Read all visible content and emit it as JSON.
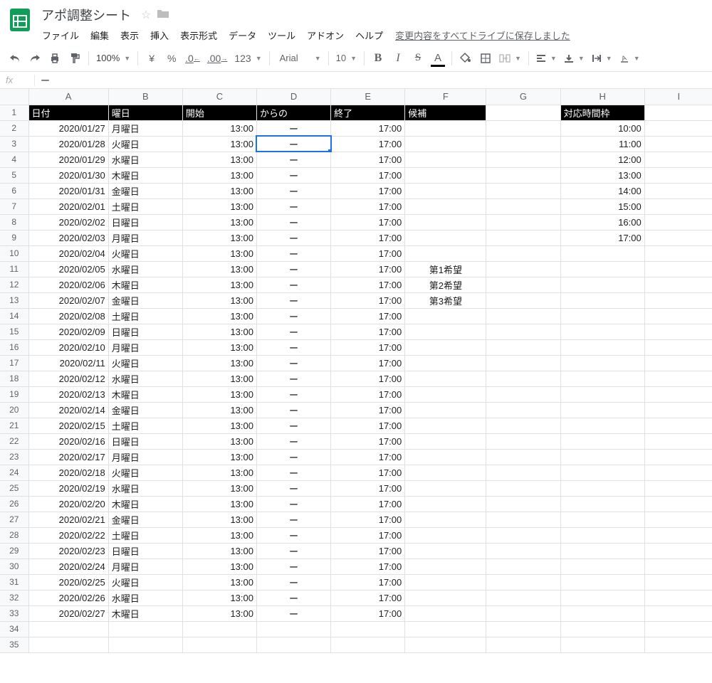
{
  "doc_title": "アポ調整シート",
  "menus": [
    "ファイル",
    "編集",
    "表示",
    "挿入",
    "表示形式",
    "データ",
    "ツール",
    "アドオン",
    "ヘルプ"
  ],
  "save_status": "変更内容をすべてドライブに保存しました",
  "toolbar": {
    "zoom": "100%",
    "currency": "¥",
    "percent": "%",
    "dec_dec": ".0",
    "inc_dec": ".00",
    "num_fmt": "123",
    "font_name": "Arial",
    "font_size": "10",
    "text_color_letter": "A"
  },
  "formula_bar": {
    "fx": "fx",
    "value": "ー"
  },
  "columns": [
    "A",
    "B",
    "C",
    "D",
    "E",
    "F",
    "G",
    "H",
    "I"
  ],
  "header_row": {
    "A": "日付",
    "B": "曜日",
    "C": "開始",
    "D": "からの",
    "E": "終了",
    "F": "候補",
    "H": "対応時間枠"
  },
  "active_cell": {
    "row": 3,
    "col": "D"
  },
  "rows": [
    {
      "n": 1,
      "hdr": true
    },
    {
      "n": 2,
      "A": "2020/01/27",
      "B": "月曜日",
      "C": "13:00",
      "D": "ー",
      "E": "17:00",
      "H": "10:00"
    },
    {
      "n": 3,
      "A": "2020/01/28",
      "B": "火曜日",
      "C": "13:00",
      "D": "ー",
      "E": "17:00",
      "H": "11:00"
    },
    {
      "n": 4,
      "A": "2020/01/29",
      "B": "水曜日",
      "C": "13:00",
      "D": "ー",
      "E": "17:00",
      "H": "12:00"
    },
    {
      "n": 5,
      "A": "2020/01/30",
      "B": "木曜日",
      "C": "13:00",
      "D": "ー",
      "E": "17:00",
      "H": "13:00"
    },
    {
      "n": 6,
      "A": "2020/01/31",
      "B": "金曜日",
      "C": "13:00",
      "D": "ー",
      "E": "17:00",
      "H": "14:00"
    },
    {
      "n": 7,
      "A": "2020/02/01",
      "B": "土曜日",
      "C": "13:00",
      "D": "ー",
      "E": "17:00",
      "H": "15:00"
    },
    {
      "n": 8,
      "A": "2020/02/02",
      "B": "日曜日",
      "C": "13:00",
      "D": "ー",
      "E": "17:00",
      "H": "16:00"
    },
    {
      "n": 9,
      "A": "2020/02/03",
      "B": "月曜日",
      "C": "13:00",
      "D": "ー",
      "E": "17:00",
      "H": "17:00"
    },
    {
      "n": 10,
      "A": "2020/02/04",
      "B": "火曜日",
      "C": "13:00",
      "D": "ー",
      "E": "17:00"
    },
    {
      "n": 11,
      "A": "2020/02/05",
      "B": "水曜日",
      "C": "13:00",
      "D": "ー",
      "E": "17:00",
      "F": "第1希望"
    },
    {
      "n": 12,
      "A": "2020/02/06",
      "B": "木曜日",
      "C": "13:00",
      "D": "ー",
      "E": "17:00",
      "F": "第2希望"
    },
    {
      "n": 13,
      "A": "2020/02/07",
      "B": "金曜日",
      "C": "13:00",
      "D": "ー",
      "E": "17:00",
      "F": "第3希望"
    },
    {
      "n": 14,
      "A": "2020/02/08",
      "B": "土曜日",
      "C": "13:00",
      "D": "ー",
      "E": "17:00"
    },
    {
      "n": 15,
      "A": "2020/02/09",
      "B": "日曜日",
      "C": "13:00",
      "D": "ー",
      "E": "17:00"
    },
    {
      "n": 16,
      "A": "2020/02/10",
      "B": "月曜日",
      "C": "13:00",
      "D": "ー",
      "E": "17:00"
    },
    {
      "n": 17,
      "A": "2020/02/11",
      "B": "火曜日",
      "C": "13:00",
      "D": "ー",
      "E": "17:00"
    },
    {
      "n": 18,
      "A": "2020/02/12",
      "B": "水曜日",
      "C": "13:00",
      "D": "ー",
      "E": "17:00"
    },
    {
      "n": 19,
      "A": "2020/02/13",
      "B": "木曜日",
      "C": "13:00",
      "D": "ー",
      "E": "17:00"
    },
    {
      "n": 20,
      "A": "2020/02/14",
      "B": "金曜日",
      "C": "13:00",
      "D": "ー",
      "E": "17:00"
    },
    {
      "n": 21,
      "A": "2020/02/15",
      "B": "土曜日",
      "C": "13:00",
      "D": "ー",
      "E": "17:00"
    },
    {
      "n": 22,
      "A": "2020/02/16",
      "B": "日曜日",
      "C": "13:00",
      "D": "ー",
      "E": "17:00"
    },
    {
      "n": 23,
      "A": "2020/02/17",
      "B": "月曜日",
      "C": "13:00",
      "D": "ー",
      "E": "17:00"
    },
    {
      "n": 24,
      "A": "2020/02/18",
      "B": "火曜日",
      "C": "13:00",
      "D": "ー",
      "E": "17:00"
    },
    {
      "n": 25,
      "A": "2020/02/19",
      "B": "水曜日",
      "C": "13:00",
      "D": "ー",
      "E": "17:00"
    },
    {
      "n": 26,
      "A": "2020/02/20",
      "B": "木曜日",
      "C": "13:00",
      "D": "ー",
      "E": "17:00"
    },
    {
      "n": 27,
      "A": "2020/02/21",
      "B": "金曜日",
      "C": "13:00",
      "D": "ー",
      "E": "17:00"
    },
    {
      "n": 28,
      "A": "2020/02/22",
      "B": "土曜日",
      "C": "13:00",
      "D": "ー",
      "E": "17:00"
    },
    {
      "n": 29,
      "A": "2020/02/23",
      "B": "日曜日",
      "C": "13:00",
      "D": "ー",
      "E": "17:00"
    },
    {
      "n": 30,
      "A": "2020/02/24",
      "B": "月曜日",
      "C": "13:00",
      "D": "ー",
      "E": "17:00"
    },
    {
      "n": 31,
      "A": "2020/02/25",
      "B": "火曜日",
      "C": "13:00",
      "D": "ー",
      "E": "17:00"
    },
    {
      "n": 32,
      "A": "2020/02/26",
      "B": "水曜日",
      "C": "13:00",
      "D": "ー",
      "E": "17:00"
    },
    {
      "n": 33,
      "A": "2020/02/27",
      "B": "木曜日",
      "C": "13:00",
      "D": "ー",
      "E": "17:00"
    },
    {
      "n": 34
    },
    {
      "n": 35
    }
  ]
}
